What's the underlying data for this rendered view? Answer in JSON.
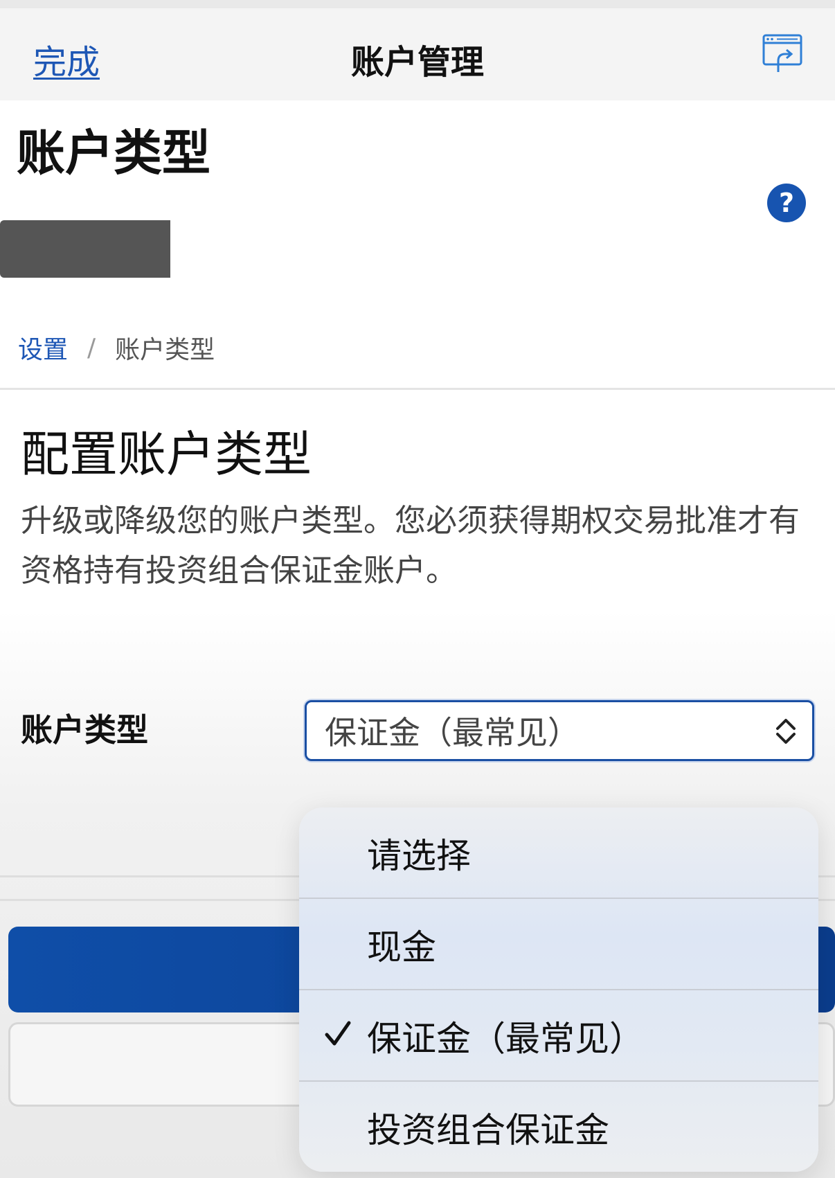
{
  "nav": {
    "done_label": "完成",
    "title": "账户管理",
    "share_icon": "window-share-icon"
  },
  "page": {
    "heading": "账户类型",
    "help_icon": "question-circle-icon",
    "help_glyph": "?"
  },
  "breadcrumb": {
    "items": [
      "设置",
      "账户类型"
    ],
    "separator": "/"
  },
  "section": {
    "title": "配置账户类型",
    "description": "升级或降级您的账户类型。您必须获得期权交易批准才有资格持有投资组合保证金账户。"
  },
  "form": {
    "account_type_label": "账户类型",
    "selected_value": "保证金（最常见）",
    "select_icon": "chevron-up-down-icon"
  },
  "dropdown": {
    "options": [
      {
        "label": "请选择",
        "checked": false
      },
      {
        "label": "现金",
        "checked": false
      },
      {
        "label": "保证金（最常见）",
        "checked": true
      },
      {
        "label": "投资组合保证金",
        "checked": false
      }
    ],
    "check_icon": "checkmark-icon"
  },
  "colors": {
    "accent": "#1e57b5",
    "primary_button": "#0f4ea8",
    "redacted": "#555555"
  }
}
